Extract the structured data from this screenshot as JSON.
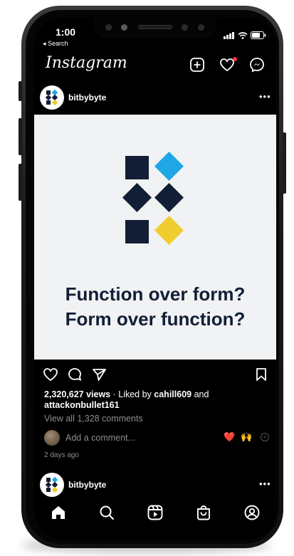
{
  "status_bar": {
    "time": "1:00",
    "back_label": "◂ Search"
  },
  "header": {
    "logo": "Instagram",
    "icons": [
      "add-post-icon",
      "heart-icon",
      "messenger-icon"
    ],
    "notification_color": "#ff3040"
  },
  "post": {
    "username": "bitbybyte",
    "menu": "•••",
    "image": {
      "background": "#f1f2f4",
      "shape_colors": {
        "navy": "#121e36",
        "blue": "#1ea7e4",
        "yellow": "#f0cd2f"
      },
      "caption_line1": "Function over form?",
      "caption_line2": "Form over function?"
    },
    "views": "2,320,627 views",
    "liked_by_prefix": " · Liked by ",
    "liked_user1": "cahill609",
    "liked_and": " and",
    "liked_user2": "attackonbullet161",
    "view_comments": "View all 1,328 comments",
    "add_comment_placeholder": "Add a comment...",
    "quick_emojis": [
      "❤️",
      "🙌"
    ],
    "time_ago": "2 days ago"
  },
  "next_post": {
    "username": "bitbybyte",
    "menu": "•••"
  },
  "bottom_nav": {
    "items": [
      "home-icon",
      "search-icon",
      "reels-icon",
      "shop-icon",
      "profile-icon"
    ]
  }
}
